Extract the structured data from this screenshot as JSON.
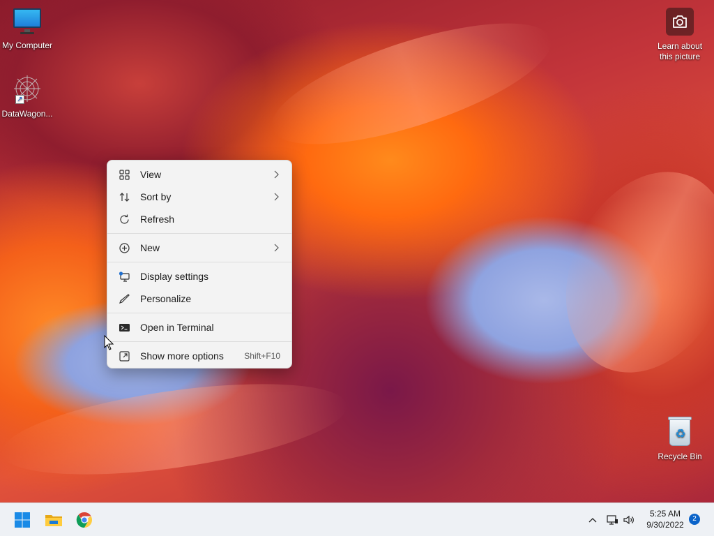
{
  "desktop": {
    "icons": [
      {
        "label": "My Computer",
        "icon": "monitor-icon"
      },
      {
        "label": "DataWagon...",
        "icon": "datawagon-star-icon"
      },
      {
        "label": "Recycle Bin",
        "icon": "recycle-bin-icon"
      }
    ],
    "learn_about_picture": {
      "line1": "Learn about",
      "line2": "this picture",
      "icon": "camera-icon"
    }
  },
  "context_menu": {
    "items": [
      {
        "label": "View",
        "icon": "view-grid-icon",
        "submenu": true
      },
      {
        "label": "Sort by",
        "icon": "sort-icon",
        "submenu": true
      },
      {
        "label": "Refresh",
        "icon": "refresh-icon"
      },
      {
        "label": "New",
        "icon": "new-plus-icon",
        "submenu": true
      },
      {
        "label": "Display settings",
        "icon": "display-settings-icon"
      },
      {
        "label": "Personalize",
        "icon": "personalize-pen-icon"
      },
      {
        "label": "Open in Terminal",
        "icon": "terminal-icon"
      },
      {
        "label": "Show more options",
        "icon": "show-more-icon",
        "shortcut": "Shift+F10"
      }
    ]
  },
  "taskbar": {
    "apps": [
      {
        "name": "Start",
        "icon": "windows-start-icon"
      },
      {
        "name": "File Explorer",
        "icon": "file-explorer-icon"
      },
      {
        "name": "Google Chrome",
        "icon": "chrome-icon"
      }
    ],
    "tray": {
      "time": "5:25 AM",
      "date": "9/30/2022",
      "notification_count": "2"
    }
  },
  "colors": {
    "accent": "#0a63c9",
    "menu_bg": "#f3f3f3",
    "taskbar_bg": "#eef1f5"
  }
}
